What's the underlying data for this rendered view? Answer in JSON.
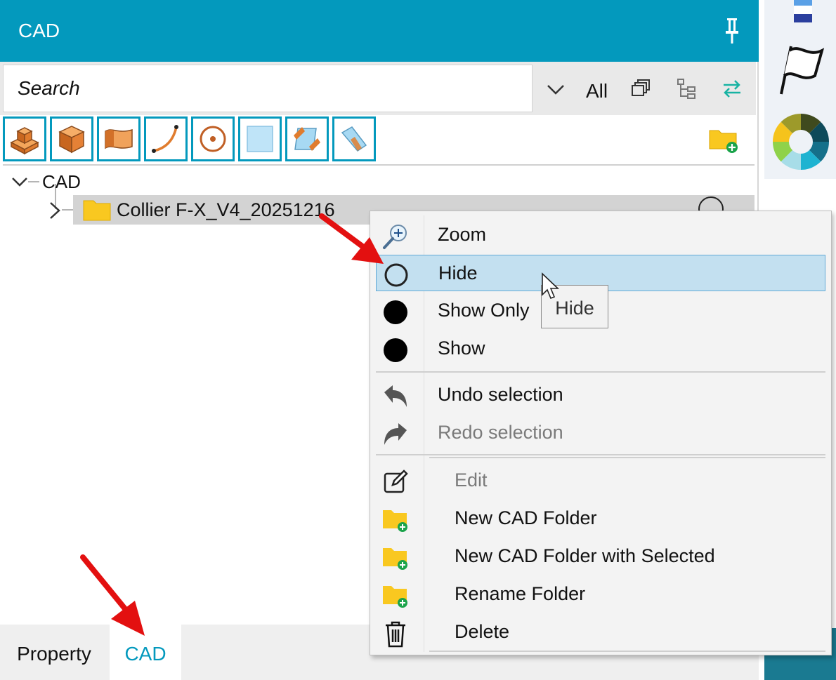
{
  "panel": {
    "title": "CAD",
    "search": {
      "placeholder": "Search",
      "value": ""
    },
    "filter": {
      "selected": "All"
    }
  },
  "tree": {
    "root_label": "CAD",
    "items": [
      {
        "label": "Collier F-X_V4_20251216",
        "expanded": false
      }
    ]
  },
  "tabs": {
    "property": "Property",
    "cad": "CAD",
    "active": "CAD"
  },
  "context_menu": {
    "items": [
      {
        "label": "Zoom",
        "icon": "zoom-in-icon",
        "enabled": true
      },
      {
        "label": "Hide",
        "icon": "circle-outline-icon",
        "enabled": true,
        "highlighted": true
      },
      {
        "label": "Show Only",
        "icon": "filled-circle-icon",
        "enabled": true
      },
      {
        "label": "Show",
        "icon": "filled-circle-icon",
        "enabled": true
      },
      {
        "label": "Undo selection",
        "icon": "undo-icon",
        "enabled": true
      },
      {
        "label": "Redo selection",
        "icon": "redo-icon",
        "enabled": false
      },
      {
        "label": "Edit",
        "icon": "edit-icon",
        "enabled": false
      },
      {
        "label": "New CAD Folder",
        "icon": "folder-add-icon",
        "enabled": true
      },
      {
        "label": "New CAD Folder with Selected",
        "icon": "folder-add-icon",
        "enabled": true
      },
      {
        "label": "Rename Folder",
        "icon": "folder-add-icon",
        "enabled": true
      },
      {
        "label": "Delete",
        "icon": "trash-icon",
        "enabled": true
      }
    ]
  },
  "tooltip": {
    "text": "Hide"
  },
  "colors": {
    "accent": "#0399bd",
    "highlight": "#c3e0f0",
    "annotation_arrow": "#e31010"
  }
}
